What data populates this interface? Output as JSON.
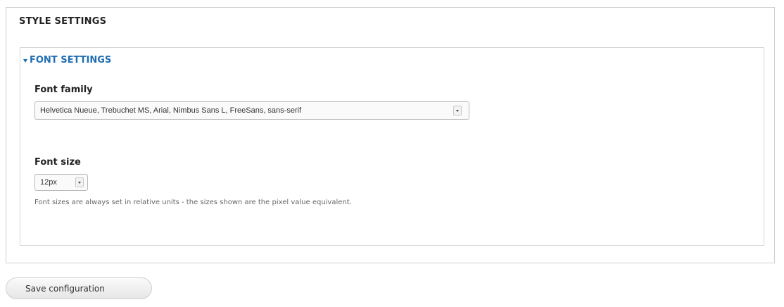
{
  "style_settings": {
    "title": "STYLE SETTINGS",
    "font_settings": {
      "title": "FONT SETTINGS",
      "expanded": true,
      "font_family": {
        "label": "Font family",
        "selected": "Helvetica Nueue, Trebuchet MS, Arial, Nimbus Sans L, FreeSans, sans-serif"
      },
      "font_size": {
        "label": "Font size",
        "selected": "12px",
        "description": "Font sizes are always set in relative units - the sizes shown are the pixel value equivalent."
      }
    }
  },
  "actions": {
    "save_label": "Save configuration"
  },
  "colors": {
    "link": "#1f6db3",
    "border": "#cfcfcf"
  },
  "icons": {
    "collapse_toggle": "triangle-down-icon",
    "select_toggle": "chevron-down-icon"
  }
}
